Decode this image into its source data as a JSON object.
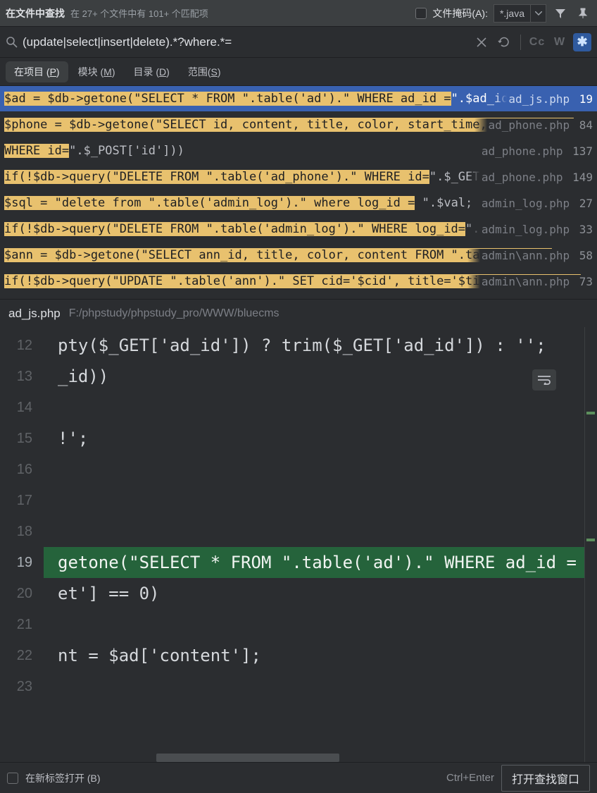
{
  "topbar": {
    "title": "在文件中查找",
    "stats": "在 27+ 个文件中有 101+ 个匹配项",
    "mask_label": "文件掩码(A):",
    "mask_value": "*.java"
  },
  "search": {
    "query": "(update|select|insert|delete).*?where.*=",
    "cc": "Cc",
    "word": "W",
    "regex": "✱"
  },
  "tabs": {
    "project": "在项目 (P)",
    "module": "模块 (M)",
    "dir": "目录 (D)",
    "scope": "范围(S)"
  },
  "results": [
    {
      "hl": "$ad = $db->getone(\"SELECT * FROM \".table('ad').\" WHERE ad_id =",
      "tail": "\".$ad_id);",
      "file": "ad_js.php",
      "line": "19",
      "selected": true
    },
    {
      "hl": " $phone = $db->getone(\"SELECT id, content, title, color, start_time, end_time, s",
      "tail": "",
      "file": "ad_phone.php",
      "line": "84"
    },
    {
      "hl": " WHERE id=",
      "tail": "\".$_POST['id']))",
      "file": "ad_phone.php",
      "line": "137"
    },
    {
      "hl": " if(!$db->query(\"DELETE FROM \".table('ad_phone').\" WHERE id=",
      "tail": "\".$_GET['id'])",
      "file": "ad_phone.php",
      "line": "149"
    },
    {
      "hl": " $sql = \"delete from \".table('admin_log').\" where log_id =",
      "tail": " \".$val;",
      "file": "admin_log.php",
      "line": "27"
    },
    {
      "hl": " if(!$db->query(\"DELETE FROM \".table('admin_log').\" WHERE log_id=",
      "tail": "\".intval($",
      "file": "admin_log.php",
      "line": "33"
    },
    {
      "hl": " $ann = $db->getone(\"SELECT ann_id, title, color, content FROM \".table('ann')",
      "tail": "",
      "file": "admin\\ann.php",
      "line": "58"
    },
    {
      "hl": " if(!$db->query(\"UPDATE \".table('ann').\" SET cid='$cid', title='$title', color='$",
      "tail": "",
      "file": "admin\\ann.php",
      "line": "73"
    }
  ],
  "preview": {
    "filename": "ad_js.php",
    "path": "F:/phpstudy/phpstudy_pro/WWW/bluecms"
  },
  "editor": {
    "start": 12,
    "current": 19,
    "lines": [
      "pty($_GET['ad_id']) ? trim($_GET['ad_id']) : '';",
      "_id))",
      "",
      "!';",
      "",
      "",
      "",
      "getone(\"SELECT * FROM \".table('ad').\" WHERE ad_id =",
      "et'] == 0)",
      "",
      "nt = $ad['content'];",
      ""
    ]
  },
  "footer": {
    "newtab": "在新标签打开 (B)",
    "shortcut": "Ctrl+Enter",
    "open": "打开查找窗口"
  }
}
